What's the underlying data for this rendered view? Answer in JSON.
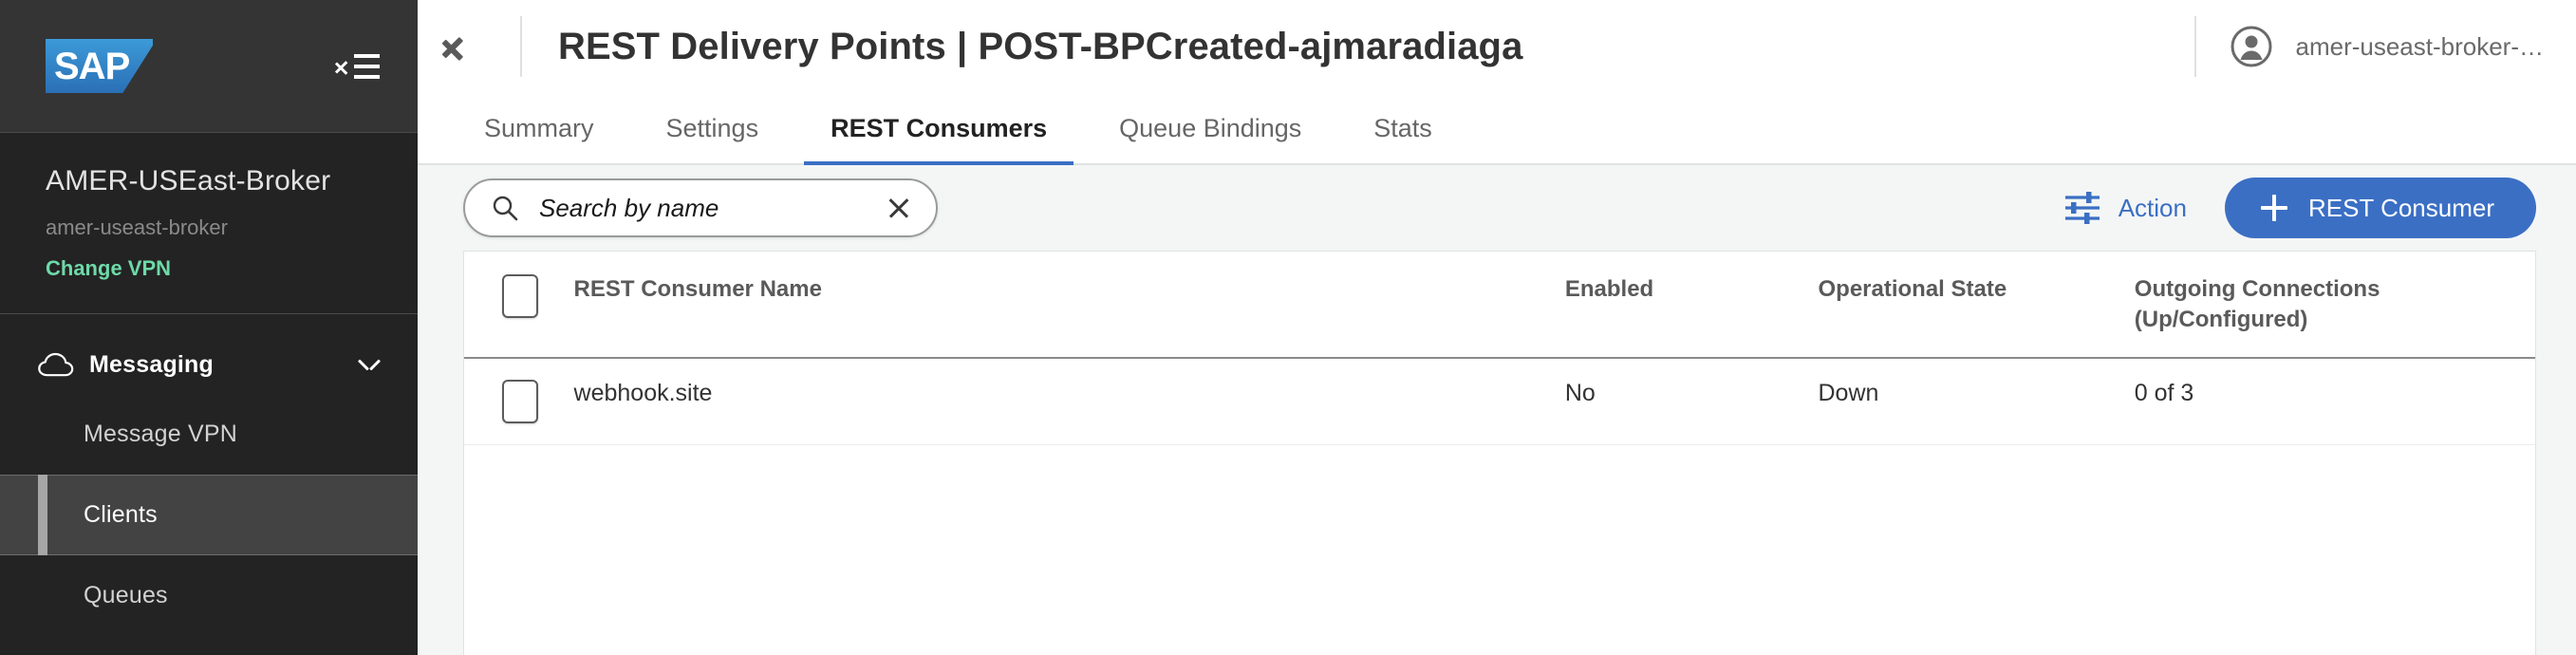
{
  "sidebar": {
    "logo_text": "SAP",
    "logo_name": "sap-logo",
    "collapse_icon": "collapse-menu-icon",
    "vpn": {
      "title": "AMER-USEast-Broker",
      "subtitle": "amer-useast-broker",
      "change_link": "Change VPN",
      "change_link_color": "#6ed9a8"
    },
    "nav_group": {
      "label": "Messaging",
      "icon": "cloud-icon",
      "chevron": "chevron-down-icon",
      "expanded": true
    },
    "items": [
      {
        "label": "Message VPN",
        "active": false
      },
      {
        "label": "Clients",
        "active": true
      },
      {
        "label": "Queues",
        "active": false
      }
    ]
  },
  "topbar": {
    "back_icon": "back-chevron-icon",
    "title": "REST Delivery Points | POST-BPCreated-ajmaradiaga",
    "user": {
      "avatar_icon": "user-avatar-icon",
      "name": "amer-useast-broker-…"
    }
  },
  "tabs": [
    {
      "label": "Summary",
      "active": false
    },
    {
      "label": "Settings",
      "active": false
    },
    {
      "label": "REST Consumers",
      "active": true
    },
    {
      "label": "Queue Bindings",
      "active": false
    },
    {
      "label": "Stats",
      "active": false
    }
  ],
  "tab_accent_color": "#3b6fc4",
  "toolbar": {
    "search": {
      "placeholder": "Search by name",
      "value": "",
      "search_icon": "search-icon",
      "clear_icon": "clear-icon"
    },
    "action": {
      "label": "Action",
      "icon": "sliders-icon",
      "color": "#3b6fc4"
    },
    "primary": {
      "label": "REST Consumer",
      "icon": "plus-icon",
      "color": "#3b6fc4"
    }
  },
  "table": {
    "headers": {
      "select_all": "",
      "name": "REST Consumer Name",
      "enabled": "Enabled",
      "operational_state": "Operational State",
      "outgoing": "Outgoing Connections (Up/Configured)"
    },
    "rows": [
      {
        "name": "webhook.site",
        "enabled": "No",
        "operational_state": "Down",
        "operational_state_color": "#c0392b",
        "outgoing": "0 of 3"
      }
    ]
  }
}
